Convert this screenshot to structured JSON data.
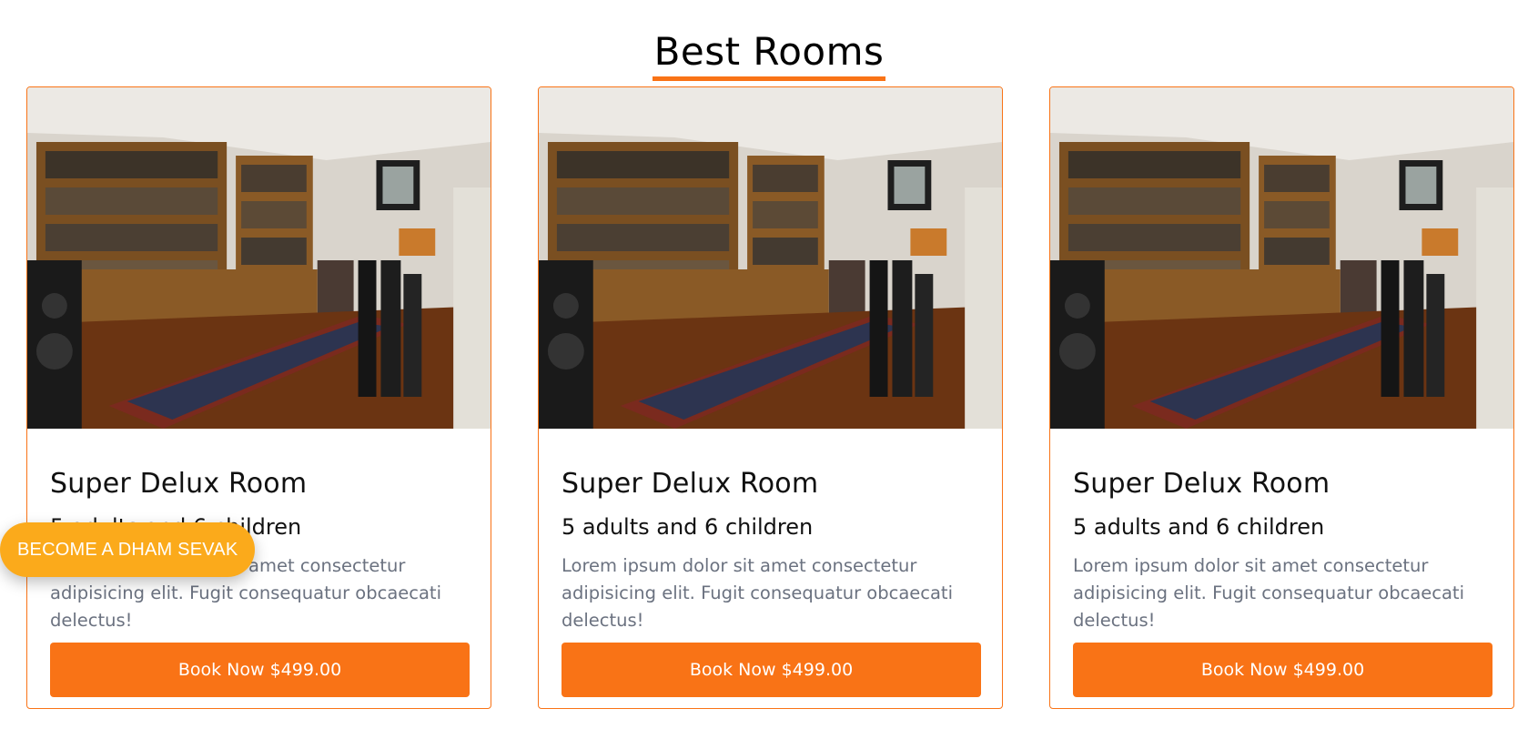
{
  "section": {
    "title": "Best Rooms"
  },
  "rooms": [
    {
      "title": "Super Delux Room",
      "capacity": "5 adults and 6 children",
      "description": "Lorem ipsum dolor sit amet consectetur adipisicing elit. Fugit consequatur obcaecati delectus!",
      "button_label": "Book Now $499.00"
    },
    {
      "title": "Super Delux Room",
      "capacity": "5 adults and 6 children",
      "description": "Lorem ipsum dolor sit amet consectetur adipisicing elit. Fugit consequatur obcaecati delectus!",
      "button_label": "Book Now $499.00"
    },
    {
      "title": "Super Delux Room",
      "capacity": "5 adults and 6 children",
      "description": "Lorem ipsum dolor sit amet consectetur adipisicing elit. Fugit consequatur obcaecati delectus!",
      "button_label": "Book Now $499.00"
    }
  ],
  "floating_cta": {
    "label": "BECOME A DHAM SEVAK"
  },
  "colors": {
    "accent": "#f97316",
    "cta": "#fbaa1b",
    "muted_text": "#6b7280"
  }
}
